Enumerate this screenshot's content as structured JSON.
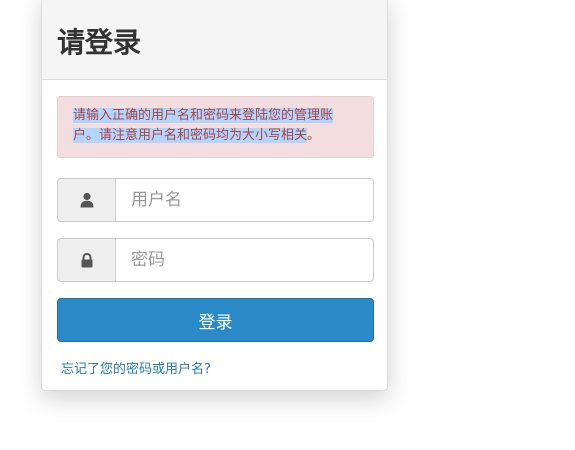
{
  "login": {
    "title": "请登录",
    "alert_selected": "请输入正确的用户名和密码来登陆您的管理账户。请注意用户名和密码均为大小写相关",
    "alert_rest": "。",
    "username_placeholder": "用户名",
    "password_placeholder": "密码",
    "submit_label": "登录",
    "forgot_link": "忘记了您的密码或用户名?"
  },
  "colors": {
    "alert_bg": "#f2dede",
    "alert_text": "#a94442",
    "primary": "#2a8ac8",
    "link": "#2a7ab8"
  },
  "icons": {
    "username": "user-icon",
    "password": "lock-icon"
  }
}
